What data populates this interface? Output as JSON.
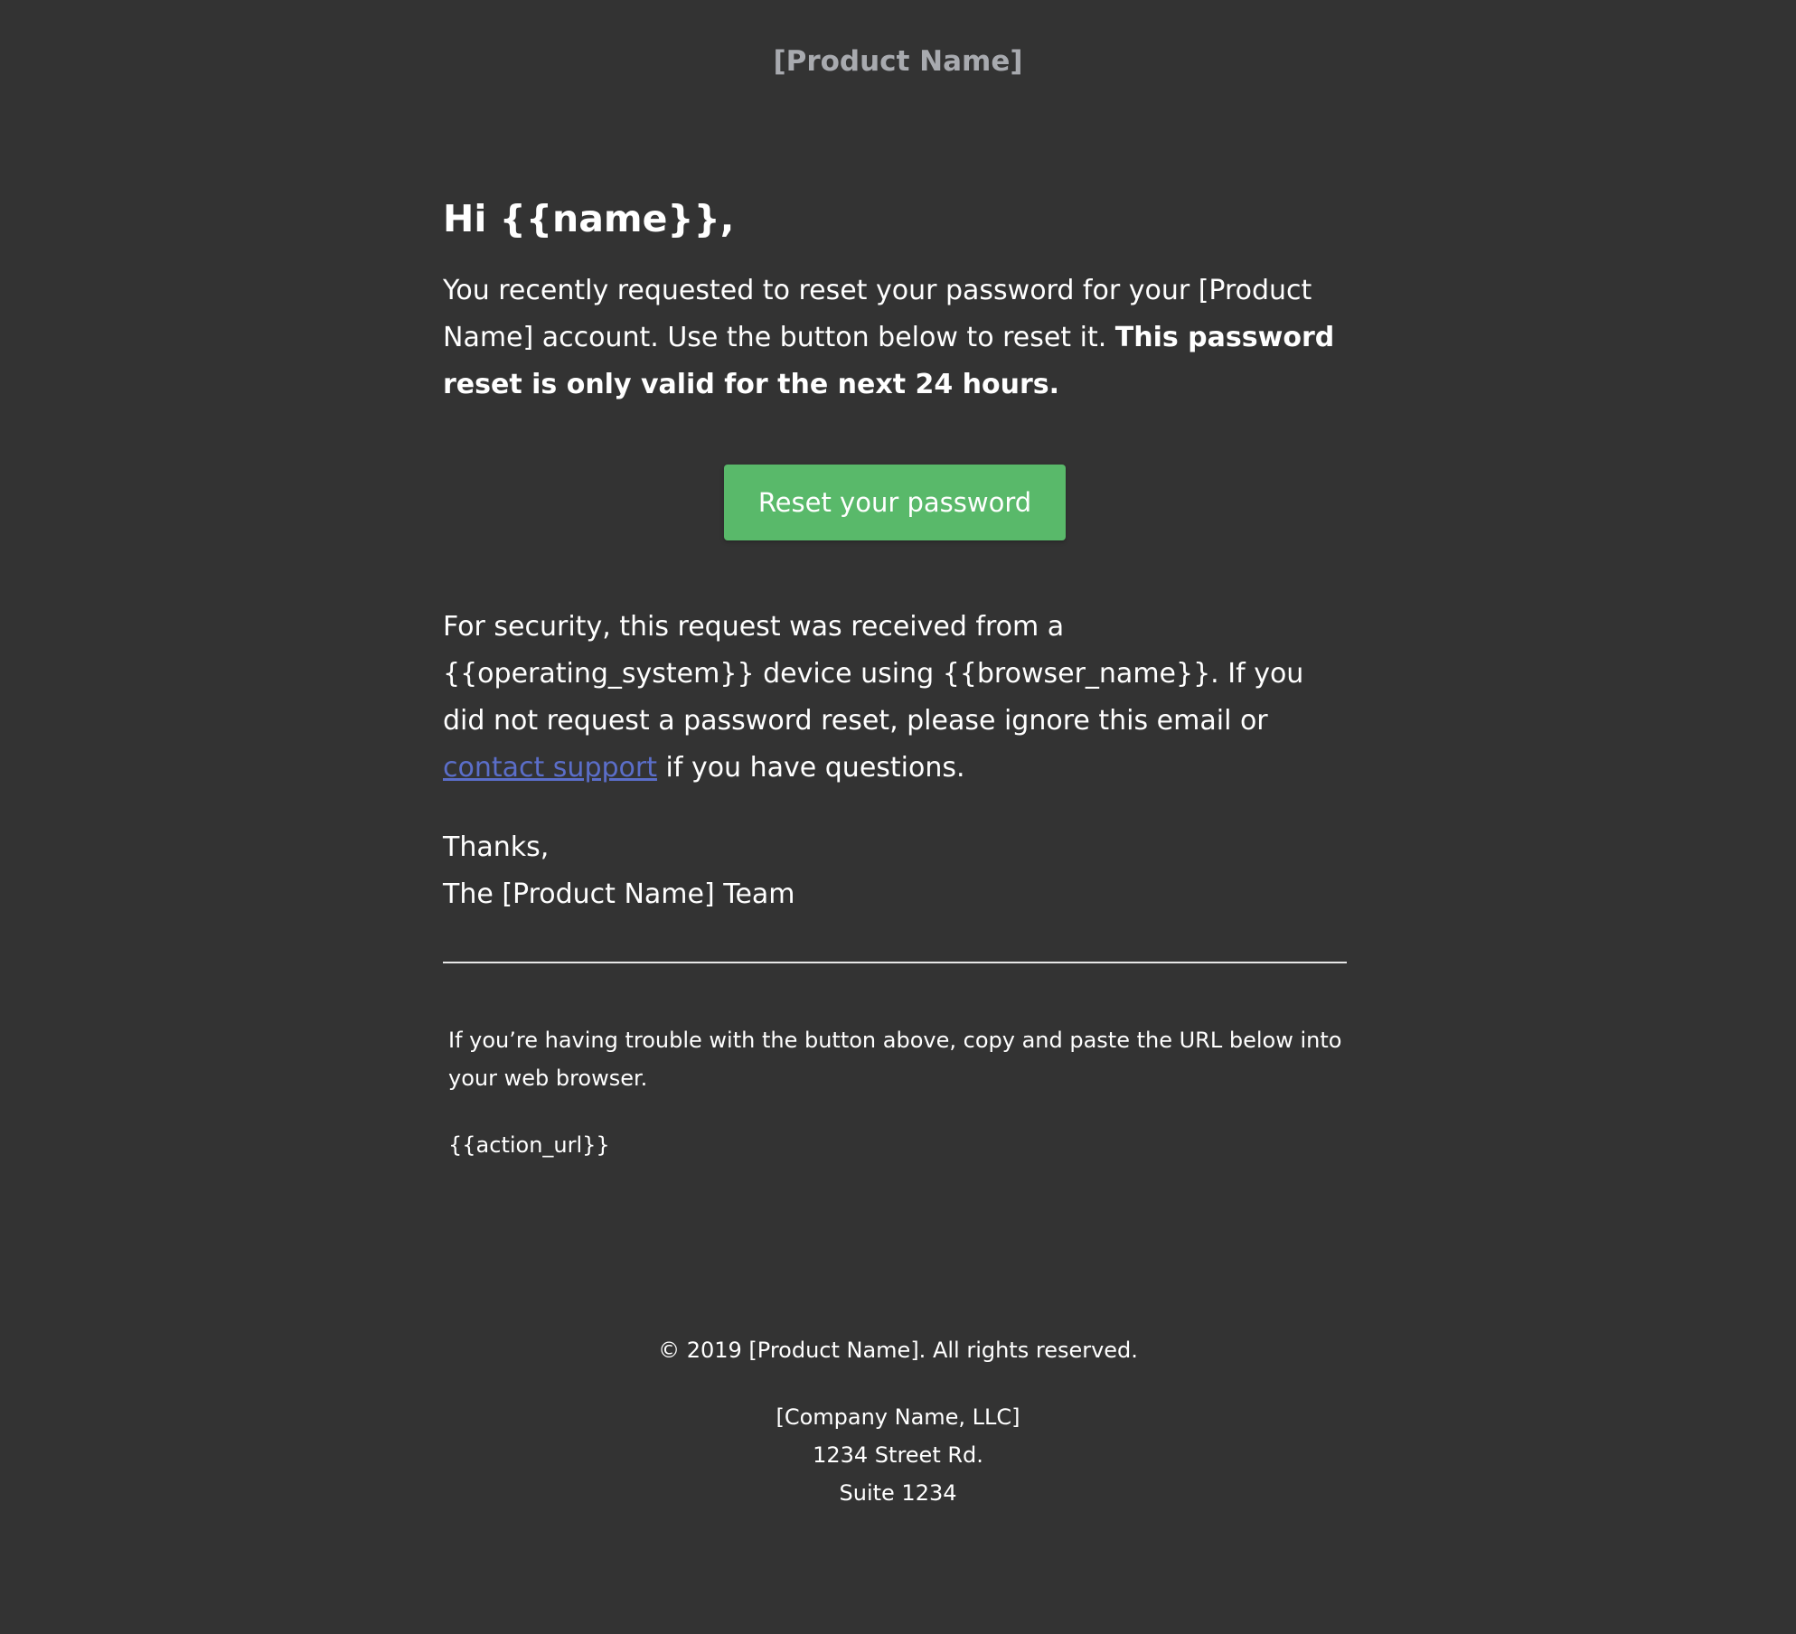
{
  "header": {
    "product_name": "[Product Name]"
  },
  "email": {
    "greeting": "Hi {{name}},",
    "intro_text": "You recently requested to reset your password for your [Product Name] account. Use the button below to reset it. ",
    "intro_bold": "This password reset is only valid for the next 24 hours.",
    "button_label": "Reset your password",
    "security_text_1": "For security, this request was received from a {{operating_system}} device using {{browser_name}}. If you did not request a password reset, please ignore this email or ",
    "support_link": "contact support",
    "security_text_2": " if you have questions.",
    "thanks": "Thanks,",
    "team": "The [Product Name] Team"
  },
  "subcopy": {
    "trouble_text": "If you’re having trouble with the button above, copy and paste the URL below into your web browser.",
    "action_url": "{{action_url}}"
  },
  "footer": {
    "copyright": "© 2019 [Product Name]. All rights reserved.",
    "company": "[Company Name, LLC]",
    "street": "1234 Street Rd.",
    "suite": "Suite 1234"
  },
  "colors": {
    "background": "#333333",
    "button": "#59b96a",
    "link": "#5b6ec9",
    "masthead": "#a8aaaf"
  }
}
